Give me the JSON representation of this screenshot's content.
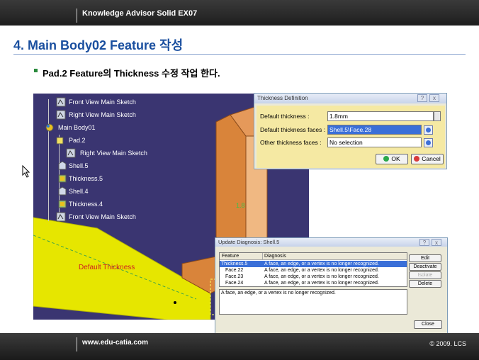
{
  "header": {
    "app_title": "Knowledge Advisor Solid EX07"
  },
  "slide": {
    "title": "4. Main Body02 Feature 작성",
    "bullet": "Pad.2 Feature의 Thickness 수정 작업 한다."
  },
  "tree": {
    "items": [
      {
        "label": "Front View Main Sketch",
        "icon": "sketch-icon"
      },
      {
        "label": "Right View Main Sketch",
        "icon": "sketch-icon"
      },
      {
        "label": "Main Body01",
        "icon": "body-icon"
      },
      {
        "label": "Pad.2",
        "icon": "pad-icon"
      },
      {
        "label": "Right View Main Sketch",
        "icon": "sketch-icon"
      },
      {
        "label": "Shell.5",
        "icon": "shell-icon"
      },
      {
        "label": "Thickness.5",
        "icon": "thickness-icon"
      },
      {
        "label": "Shell.4",
        "icon": "shell-icon"
      },
      {
        "label": "Thickness.4",
        "icon": "thickness-icon"
      },
      {
        "label": "Front View Main Sketch",
        "icon": "sketch-icon"
      }
    ]
  },
  "viewport": {
    "dimension_label": "1.8",
    "default_thickness_label": "Default Thickness"
  },
  "thickness_dialog": {
    "title": "Thickness Definition",
    "help_glyph": "?",
    "close_glyph": "x",
    "default_thickness_label": "Default thickness :",
    "default_thickness_value": "1.8mm",
    "default_faces_label": "Default thickness faces :",
    "default_faces_value": "Shell.5\\Face.28",
    "other_faces_label": "Other thickness faces :",
    "other_faces_value": "No selection",
    "ok_label": "OK",
    "cancel_label": "Cancel"
  },
  "update_dialog": {
    "title": "Update Diagnosis: Shell.5",
    "help_glyph": "?",
    "close_glyph": "x",
    "columns": [
      "Feature",
      "Diagnosis"
    ],
    "rows": [
      {
        "feature": "Thickness.5",
        "diagnosis": "A face, an edge, or a vertex is no longer recognized."
      },
      {
        "feature": "Face.22",
        "diagnosis": "A face, an edge, or a vertex is no longer recognized."
      },
      {
        "feature": "Face.23",
        "diagnosis": "A face, an edge, or a vertex is no longer recognized."
      },
      {
        "feature": "Face.24",
        "diagnosis": "A face, an edge, or a vertex is no longer recognized."
      }
    ],
    "message": "A face, an edge, or a vertex is no longer recognized.",
    "edit_label": "Edit",
    "deactivate_label": "Deactivate",
    "isolate_label": "Isolate",
    "delete_label": "Delete",
    "close_label": "Close"
  },
  "footer": {
    "website": "www.edu-catia.com",
    "copyright": "© 2009. LCS"
  },
  "colors": {
    "title_blue": "#1a4f9f",
    "bullet_green": "#2a8a3c",
    "viewport_bg": "#3a3571",
    "selection_blue": "#3a6fd8",
    "part_yellow": "#e6e600",
    "part_orange": "#d9843a"
  }
}
